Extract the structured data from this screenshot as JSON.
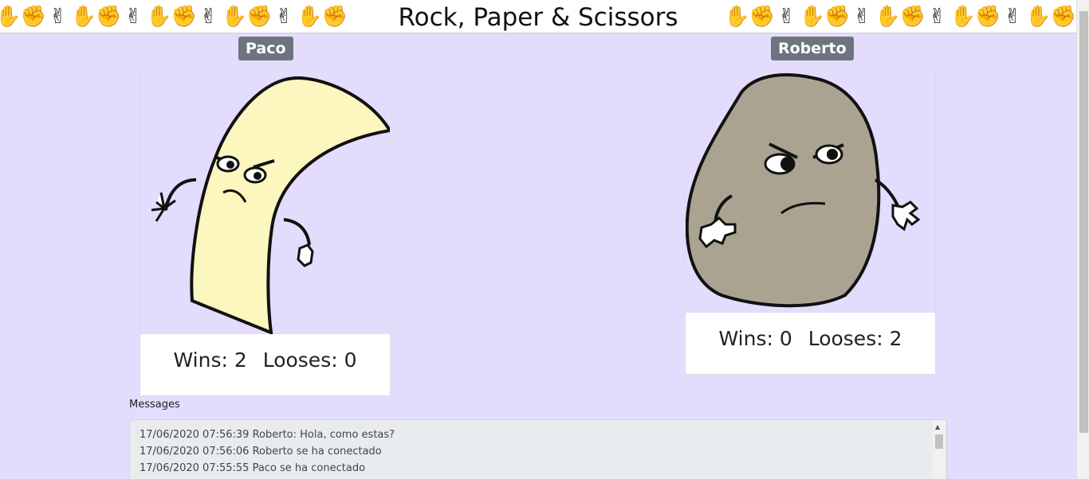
{
  "header": {
    "title": "Rock, Paper & Scissors",
    "hands_left": [
      "✋",
      "✊",
      "✌",
      "✋",
      "✊",
      "✌",
      "✋",
      "✊",
      "✌",
      "✋",
      "✊",
      "✌",
      "✋",
      "✊"
    ],
    "hands_right": [
      "✋",
      "✊",
      "✌",
      "✋",
      "✊",
      "✌",
      "✋",
      "✊",
      "✌",
      "✋",
      "✊",
      "✌",
      "✋",
      "✊"
    ]
  },
  "players": [
    {
      "name": "Paco",
      "character": "paper",
      "wins_label": "Wins: 2",
      "looses_label": "Looses: 0"
    },
    {
      "name": "Roberto",
      "character": "rock",
      "wins_label": "Wins: 0",
      "looses_label": "Looses: 2"
    }
  ],
  "messages": {
    "label": "Messages",
    "lines": [
      "17/06/2020 07:56:39 Roberto: Hola, como estas?",
      "17/06/2020 07:56:06 Roberto se ha conectado",
      "17/06/2020 07:55:55 Paco se ha conectado"
    ]
  },
  "colors": {
    "background": "#e3dcfd",
    "badge": "#6c757d",
    "paper": "#fcf6bf",
    "rock": "#aba392"
  }
}
